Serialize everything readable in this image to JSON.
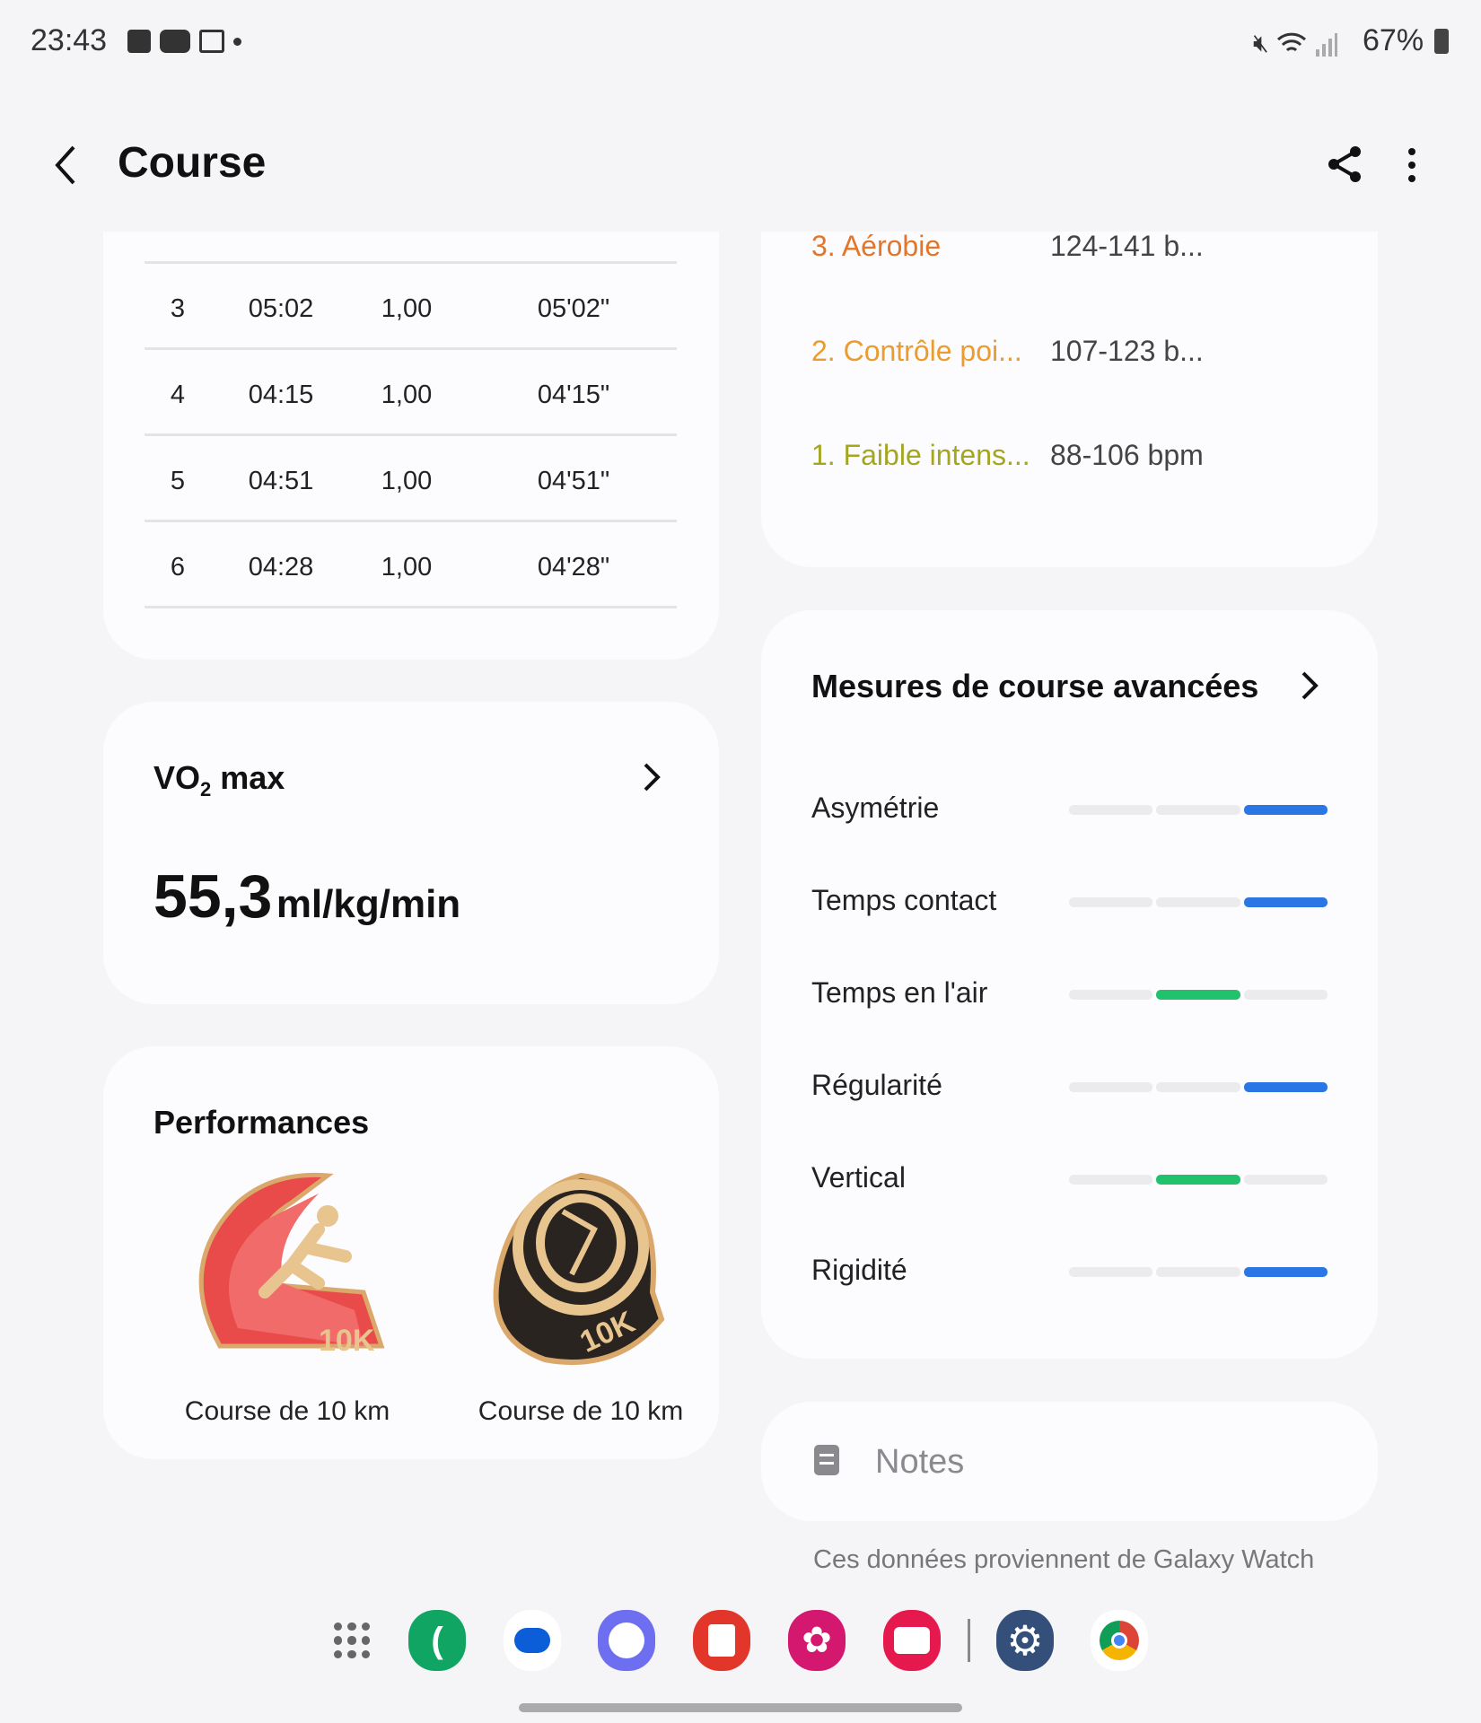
{
  "status_bar": {
    "time": "23:43",
    "battery": "67%",
    "icons": [
      "gallery-icon",
      "youtube-icon",
      "calendar-icon",
      "mute-icon",
      "wifi-icon",
      "signal-icon",
      "battery-icon"
    ]
  },
  "header": {
    "title": "Course",
    "back": "back-icon",
    "share": "share-icon",
    "more": "more-icon"
  },
  "splits": {
    "rows": [
      {
        "km": "3",
        "time": "05:02",
        "dist": "1,00",
        "pace": "05'02\""
      },
      {
        "km": "4",
        "time": "04:15",
        "dist": "1,00",
        "pace": "04'15\""
      },
      {
        "km": "5",
        "time": "04:51",
        "dist": "1,00",
        "pace": "04'51\""
      },
      {
        "km": "6",
        "time": "04:28",
        "dist": "1,00",
        "pace": "04'28\""
      }
    ]
  },
  "zones": [
    {
      "label": "3. Aérobie",
      "range": "124-141 b...",
      "color": "#e2762b"
    },
    {
      "label": "2. Contrôle poi...",
      "range": "107-123 b...",
      "color": "#ec9c2e"
    },
    {
      "label": "1. Faible intens...",
      "range": "88-106 bpm",
      "color": "#a3a61f"
    }
  ],
  "vo2": {
    "title_prefix": "VO",
    "title_sub": "2",
    "title_suffix": " max",
    "value": "55,3",
    "unit": "ml/kg/min"
  },
  "performances": {
    "title": "Performances",
    "badges": [
      {
        "label": "Course de 10 km",
        "badge_text": "10K"
      },
      {
        "label": "Course de 10 km",
        "badge_text": "10K"
      }
    ]
  },
  "advanced": {
    "title": "Mesures de course avancées",
    "metrics": [
      {
        "label": "Asymétrie",
        "level": 3,
        "color": "#2b76e5"
      },
      {
        "label": "Temps contact",
        "level": 3,
        "color": "#2b76e5"
      },
      {
        "label": "Temps en l'air",
        "level": 2,
        "color": "#22c16b"
      },
      {
        "label": "Régularité",
        "level": 3,
        "color": "#2b76e5"
      },
      {
        "label": "Vertical",
        "level": 2,
        "color": "#22c16b"
      },
      {
        "label": "Rigidité",
        "level": 3,
        "color": "#2b76e5"
      }
    ]
  },
  "notes": {
    "placeholder": "Notes"
  },
  "footer": {
    "source": "Ces données proviennent de Galaxy Watch"
  },
  "dock": [
    "apps-icon",
    "phone-icon",
    "messages-icon",
    "internet-icon",
    "notes-icon",
    "gallery-icon",
    "camera-icon",
    "settings-icon",
    "chrome-icon"
  ]
}
